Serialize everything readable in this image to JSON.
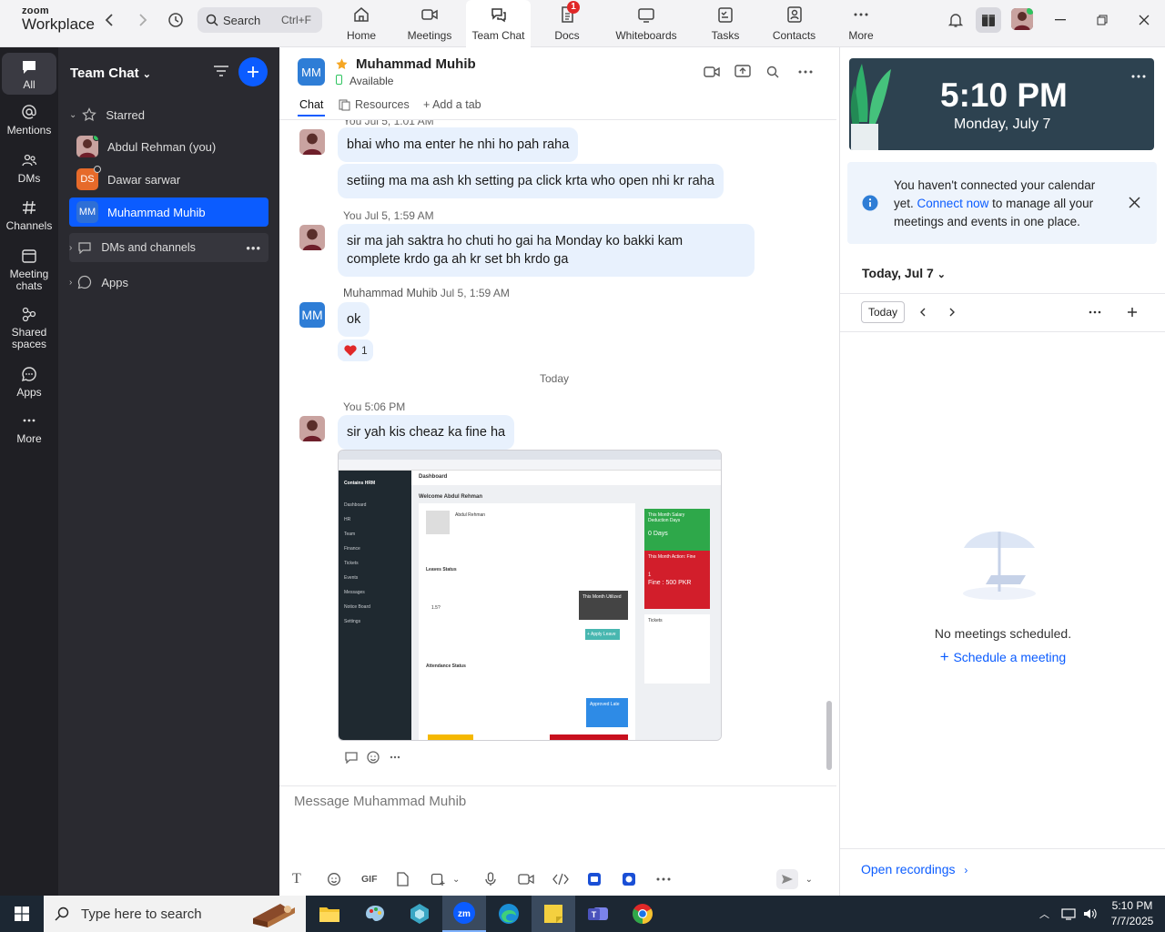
{
  "app": {
    "brand_top": "zoom",
    "brand_bottom": "Workplace"
  },
  "search": {
    "label": "Search",
    "shortcut": "Ctrl+F"
  },
  "tabs": [
    {
      "label": "Home"
    },
    {
      "label": "Meetings"
    },
    {
      "label": "Team Chat"
    },
    {
      "label": "Docs",
      "badge": "1"
    },
    {
      "label": "Whiteboards"
    },
    {
      "label": "Tasks"
    },
    {
      "label": "Contacts"
    },
    {
      "label": "More"
    }
  ],
  "rail": [
    {
      "label": "All"
    },
    {
      "label": "Mentions"
    },
    {
      "label": "DMs"
    },
    {
      "label": "Channels"
    },
    {
      "label": "Meeting chats"
    },
    {
      "label": "Shared spaces"
    },
    {
      "label": "Apps"
    },
    {
      "label": "More"
    }
  ],
  "sidebar": {
    "title": "Team Chat",
    "starred": "Starred",
    "contacts": [
      {
        "name": "Abdul Rehman (you)"
      },
      {
        "name": "Dawar sarwar",
        "initials": "DS"
      },
      {
        "name": "Muhammad Muhib",
        "initials": "MM"
      }
    ],
    "dms_channels": "DMs and channels",
    "apps": "Apps"
  },
  "chat": {
    "name": "Muhammad Muhib",
    "initials": "MM",
    "status": "Available",
    "tabs": [
      "Chat",
      "Resources",
      "Add a tab"
    ],
    "clipped_meta": "You Jul 5, 1:01 AM",
    "messages": [
      "bhai who ma enter he nhi ho pah raha",
      "setiing ma ma ash kh setting pa click krta who open nhi kr raha"
    ],
    "meta2": "You Jul 5, 1:59 AM",
    "message3_line1": "sir ma jah saktra ho chuti ho gai ha Monday ko bakki kam",
    "message3_line2": "complete krdo ga ah kr set bh krdo ga",
    "meta3_name": "Muhammad Muhib",
    "meta3_time": "Jul 5, 1:59 AM",
    "message4": "ok",
    "reaction_count": "1",
    "divider": "Today",
    "meta5": "You 5:06 PM",
    "message5": "sir yah kis cheaz ka fine ha",
    "composer_placeholder": "Message Muhammad Muhib",
    "toolbar_gif": "GIF"
  },
  "screenshot": {
    "sidebar_brand": "Contains HRM",
    "page": "Dashboard",
    "welcome": "Welcome Abdul Rehman",
    "profile_name": "Abdul Rehman",
    "leaves": "Leaves Status",
    "total_leaves": "1.5?",
    "this_month_utilized": "This Month Utilized",
    "apply_leave": "+ Apply Leave",
    "salary_card": "This Month Salary Deduction Days",
    "salary_days": "0 Days",
    "fine_card": "This Month Action: Fine",
    "fine_value": "1",
    "fine_amount": "Fine : 500 PKR",
    "tickets": "Tickets",
    "attendance": "Attendance Status",
    "approved_late": "Approved Late",
    "menu": [
      "Dashboard",
      "HR",
      "Team",
      "Finance",
      "Tickets",
      "Events",
      "Messages",
      "Notice Board",
      "Settings"
    ]
  },
  "right": {
    "time": "5:10 PM",
    "date": "Monday, July 7",
    "notice_pre": "You haven't connected your calendar yet.",
    "notice_link": "Connect now",
    "notice_post": "to manage all your meetings and events in one place.",
    "today_header": "Today, Jul 7",
    "today_btn": "Today",
    "empty": "No meetings scheduled.",
    "schedule": "Schedule a meeting",
    "recordings": "Open recordings"
  },
  "taskbar": {
    "search": "Type here to search",
    "time": "5:10 PM",
    "date": "7/7/2025"
  },
  "colors": {
    "accent": "#0b5cff",
    "sidebar_bg": "#2a2a30",
    "rail_bg": "#1f1f24",
    "bubble": "#e8f1fd",
    "clock_bg": "#2d4250",
    "red": "#e02828"
  }
}
